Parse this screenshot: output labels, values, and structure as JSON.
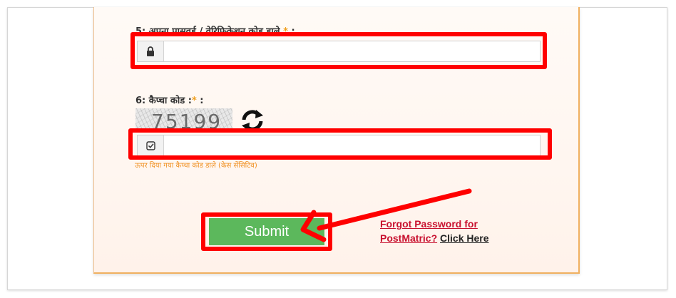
{
  "form": {
    "password_label": {
      "number": "5:",
      "text": "अपना पासवर्ड / वेरिफिकेशन कोड डाले",
      "required": "*",
      "colon": ":"
    },
    "password_value": "",
    "captcha_label": {
      "number": "6:",
      "text": "कैप्चा कोड :",
      "required": "*",
      "colon": ":"
    },
    "captcha_image_text": "75199",
    "captcha_value": "",
    "captcha_hint": "ऊपर दिया गया कैप्चा कोड डाले (केस सेंसिटिव)",
    "submit_label": "Submit",
    "forgot_password": {
      "line1": "Forgot Password for",
      "line2_part1": "PostMatric?",
      "line2_part2": "Click Here"
    }
  },
  "icons": {
    "password_addon": "lock-icon",
    "captcha_addon": "check-square-icon",
    "captcha_refresh": "refresh-icon"
  },
  "colors": {
    "highlight": "#ff0000",
    "submit_bg": "#5cb85c",
    "required_star": "#f0a020",
    "hint_text": "#f09020",
    "link_red": "#c8102e"
  }
}
